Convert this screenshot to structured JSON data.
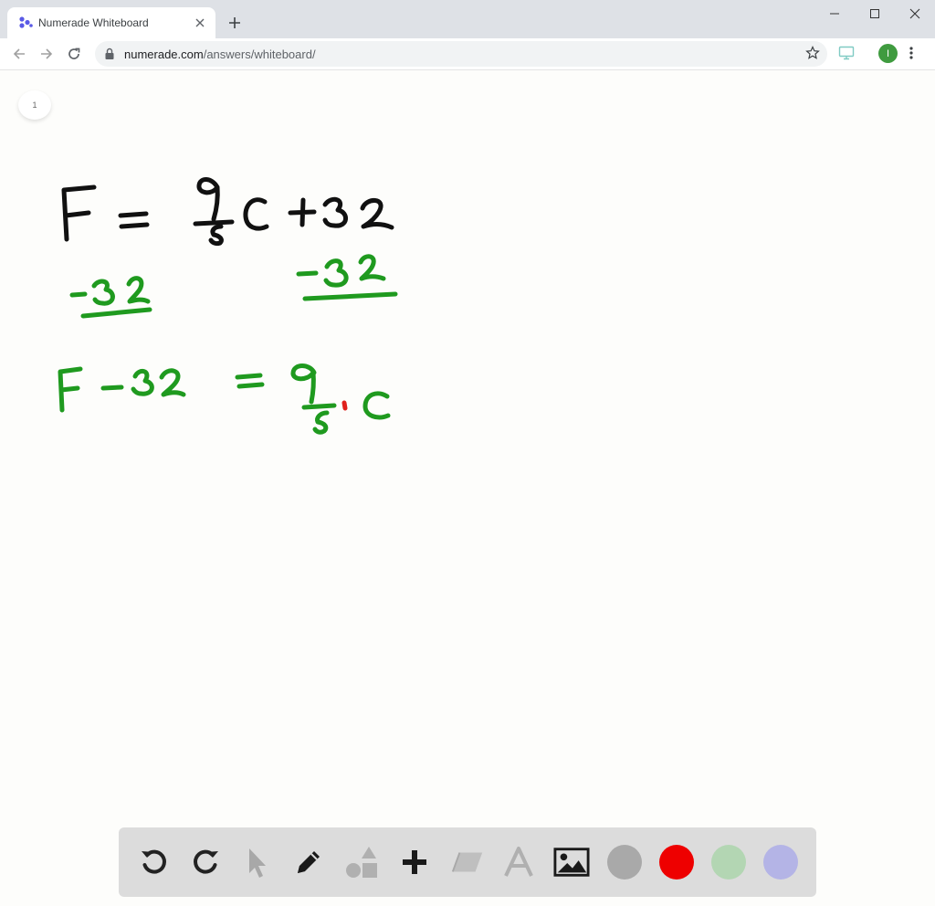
{
  "browser": {
    "tab_title": "Numerade Whiteboard",
    "url_host": "numerade.com",
    "url_path": "/answers/whiteboard/",
    "profile_initial": "I"
  },
  "whiteboard": {
    "page_number": "1",
    "ink_colors": {
      "black": "#111111",
      "green": "#1f9a1f",
      "red": "#e0201c"
    },
    "handwriting": {
      "line1": "F = 9/5 C + 32",
      "line2": "-32    -32",
      "line3": "F - 32 = 9/5 · C"
    }
  },
  "toolbar": {
    "tools": [
      "undo-icon",
      "redo-icon",
      "select-icon",
      "pen-icon",
      "shapes-icon",
      "add-icon",
      "eraser-icon",
      "text-icon",
      "image-icon"
    ],
    "swatches": [
      {
        "name": "gray",
        "color": "#a9a9a9"
      },
      {
        "name": "red",
        "color": "#ee0000"
      },
      {
        "name": "light-green",
        "color": "#b3d6b3"
      },
      {
        "name": "lavender",
        "color": "#b4b4e6"
      }
    ]
  }
}
